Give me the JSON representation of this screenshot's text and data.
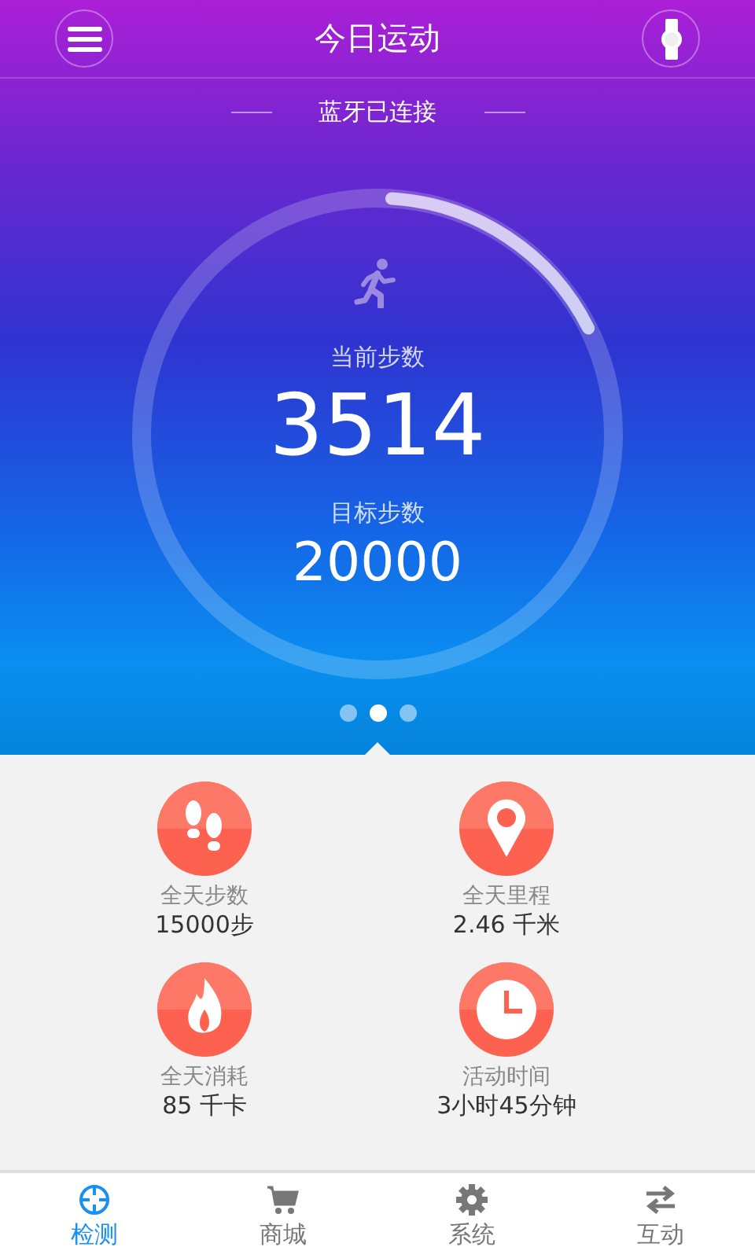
{
  "header": {
    "title": "今日运动"
  },
  "connection": {
    "status": "蓝牙已连接"
  },
  "steps": {
    "current_label": "当前步数",
    "current": "3514",
    "goal_label": "目标步数",
    "goal": "20000"
  },
  "pager": [
    {
      "selected": false
    },
    {
      "selected": true
    },
    {
      "selected": false
    }
  ],
  "stats": [
    {
      "kind": "steps",
      "label": "全天步数",
      "value": "15000步"
    },
    {
      "kind": "distance",
      "label": "全天里程",
      "value": "2.46 千米"
    },
    {
      "kind": "calories",
      "label": "全天消耗",
      "value": "85 千卡"
    },
    {
      "kind": "time",
      "label": "活动时间",
      "value": "3小时45分钟"
    }
  ],
  "tabs": [
    {
      "kind": "detect",
      "label": "检测",
      "selected": true
    },
    {
      "kind": "shop",
      "label": "商城",
      "selected": false
    },
    {
      "kind": "system",
      "label": "系统",
      "selected": false
    },
    {
      "kind": "interact",
      "label": "互动",
      "selected": false
    }
  ]
}
